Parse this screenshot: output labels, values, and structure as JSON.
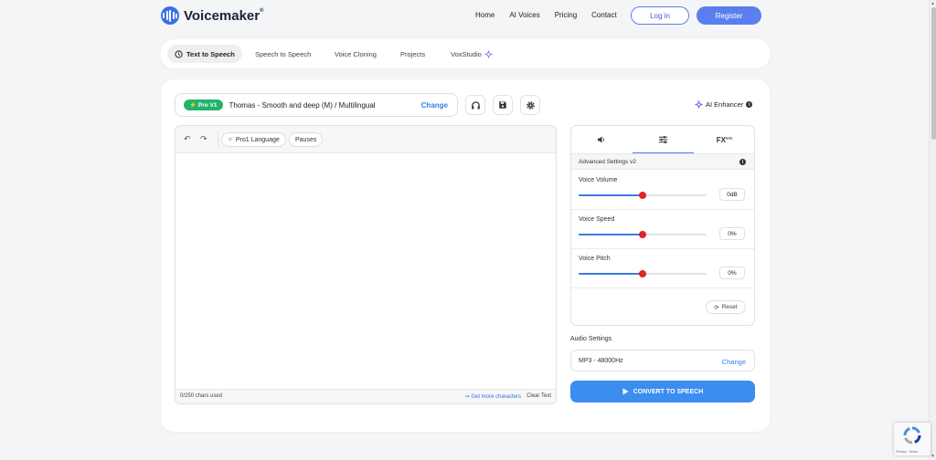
{
  "header": {
    "logo_text": "Voicemaker",
    "logo_reg": "®",
    "nav": [
      "Home",
      "AI Voices",
      "Pricing",
      "Contact"
    ],
    "login_label": "Log in",
    "register_label": "Register"
  },
  "tabs": [
    {
      "label": "Text to Speech",
      "active": true
    },
    {
      "label": "Speech to Speech",
      "active": false
    },
    {
      "label": "Voice Cloning",
      "active": false
    },
    {
      "label": "Projects",
      "active": false
    },
    {
      "label": "VoxStudio",
      "active": false
    }
  ],
  "voice": {
    "badge": "Pro V1",
    "name": "Thomas - Smooth and deep (M) / Multilingual",
    "change_label": "Change"
  },
  "ai_enhancer_label": "AI Enhancer",
  "editor": {
    "pro_language_label": "Pro1 Language",
    "pauses_label": "Pauses",
    "chars_used": "0/250 chars used",
    "more_chars_label": "Get more characters",
    "clear_label": "Clear Text"
  },
  "settings_panel": {
    "fx_tab_label": "FX",
    "fx_tab_sup": "beta",
    "advanced_label": "Advanced Settings v2",
    "sliders": [
      {
        "label": "Voice Volume",
        "value": "0dB",
        "position": 0.5
      },
      {
        "label": "Voice Speed",
        "value": "0%",
        "position": 0.5
      },
      {
        "label": "Voice Pitch",
        "value": "0%",
        "position": 0.5
      }
    ],
    "reset_label": "Reset"
  },
  "audio": {
    "label": "Audio Settings",
    "value": "MP3 - 48000Hz",
    "change_label": "Change"
  },
  "convert_label": "CONVERT TO SPEECH",
  "recaptcha_label": "Privacy - Terms",
  "colors": {
    "accent": "#3b8df0",
    "badge_green": "#22b46b",
    "slider_thumb": "#e02525"
  }
}
